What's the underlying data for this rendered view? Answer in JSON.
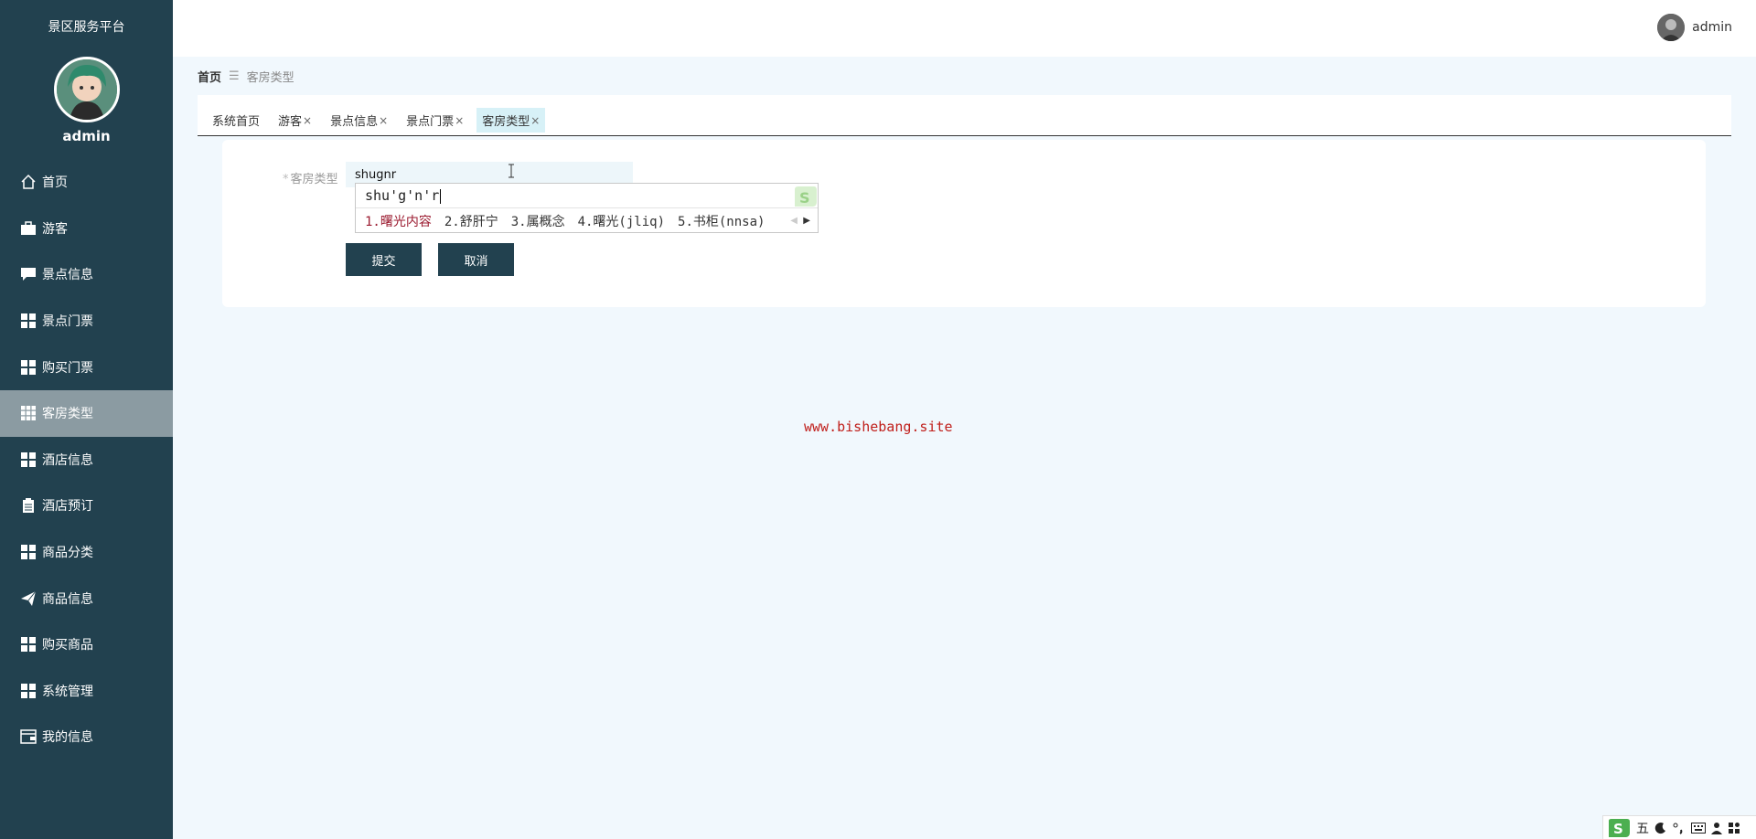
{
  "app": {
    "title": "景区服务平台",
    "username": "admin"
  },
  "header": {
    "username": "admin"
  },
  "sidebar": {
    "items": [
      {
        "label": "首页",
        "icon": "home-icon"
      },
      {
        "label": "游客",
        "icon": "briefcase-icon"
      },
      {
        "label": "景点信息",
        "icon": "comment-icon"
      },
      {
        "label": "景点门票",
        "icon": "grid-icon"
      },
      {
        "label": "购买门票",
        "icon": "grid-icon"
      },
      {
        "label": "客房类型",
        "icon": "grid-icon",
        "active": true
      },
      {
        "label": "酒店信息",
        "icon": "grid-icon"
      },
      {
        "label": "酒店预订",
        "icon": "clipboard-icon"
      },
      {
        "label": "商品分类",
        "icon": "grid-icon"
      },
      {
        "label": "商品信息",
        "icon": "paper-plane-icon"
      },
      {
        "label": "购买商品",
        "icon": "grid-icon"
      },
      {
        "label": "系统管理",
        "icon": "grid-icon"
      },
      {
        "label": "我的信息",
        "icon": "wallet-icon"
      }
    ]
  },
  "breadcrumb": {
    "home": "首页",
    "separator": "☰",
    "current": "客房类型"
  },
  "tabs": [
    {
      "label": "系统首页",
      "closable": false
    },
    {
      "label": "游客",
      "closable": true
    },
    {
      "label": "景点信息",
      "closable": true
    },
    {
      "label": "景点门票",
      "closable": true
    },
    {
      "label": "客房类型",
      "closable": true,
      "active": true
    }
  ],
  "form": {
    "required_mark": "*",
    "label": "客房类型",
    "value": "shugnr",
    "submit_label": "提交",
    "cancel_label": "取消"
  },
  "ime_popup": {
    "pinyin": "shu'g'n'r",
    "candidates": [
      "1.曙光内容",
      "2.舒肝宁",
      "3.属概念",
      "4.曙光(jliq)",
      "5.书柜(nnsa)"
    ]
  },
  "watermark": "www.bishebang.site",
  "ime_status": {
    "mode": "五"
  },
  "colors": {
    "sidebar": "#22414f",
    "active_menu": "#8b9ba2",
    "accent": "#22414f",
    "watermark": "#c0201c"
  }
}
